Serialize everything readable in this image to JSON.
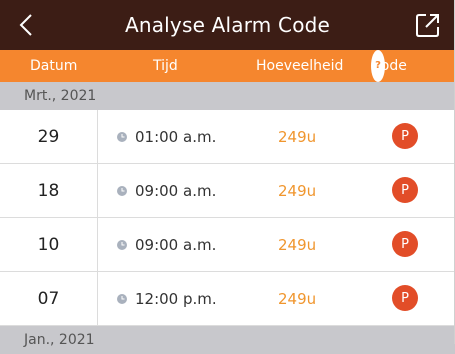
{
  "header": {
    "title": "Analyse Alarm Code"
  },
  "columns": {
    "datum": "Datum",
    "tijd": "Tijd",
    "hoeveelheid": "Hoeveelheid",
    "code": "Code"
  },
  "sections": [
    {
      "label": "Mrt., 2021",
      "rows": [
        {
          "date": "29",
          "time": "01:00 a.m.",
          "amount": "249u",
          "code": "P"
        },
        {
          "date": "18",
          "time": "09:00 a.m.",
          "amount": "249u",
          "code": "P"
        },
        {
          "date": "10",
          "time": "09:00 a.m.",
          "amount": "249u",
          "code": "P"
        },
        {
          "date": "07",
          "time": "12:00 p.m.",
          "amount": "249u",
          "code": "P"
        }
      ]
    },
    {
      "label": "Jan., 2021",
      "rows": []
    }
  ],
  "colors": {
    "header_bg": "#3c1d15",
    "column_header_bg": "#f5862e",
    "section_bg": "#c8c8cc",
    "amount_text": "#f0962e",
    "code_badge": "#e24d28"
  },
  "icons": {
    "back": "chevron-left-icon",
    "export": "export-icon",
    "help": "help-icon",
    "clock": "clock-icon"
  }
}
